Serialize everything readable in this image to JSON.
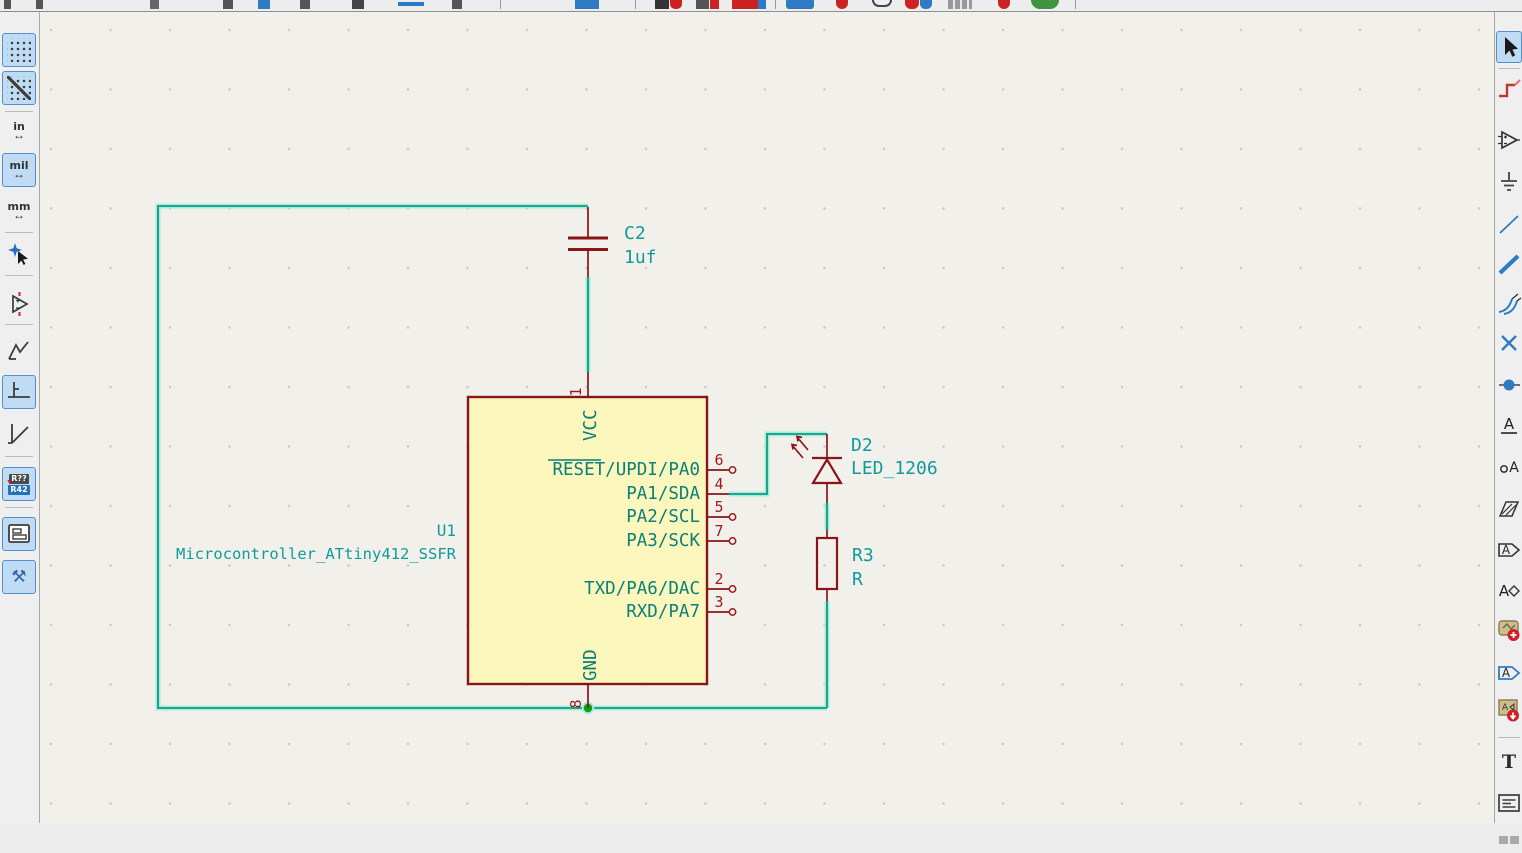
{
  "left_toolbar": {
    "buttons": [
      {
        "name": "grid-dots",
        "selected": true
      },
      {
        "name": "grid-overrides",
        "selected": true
      },
      {
        "name": "unit-inches",
        "label": "in",
        "selected": false
      },
      {
        "name": "unit-mils",
        "label": "mil",
        "selected": true
      },
      {
        "name": "unit-mm",
        "label": "mm",
        "selected": false
      },
      {
        "name": "crosshair-cursor",
        "selected": false
      },
      {
        "name": "show-hidden-pins",
        "selected": false
      },
      {
        "name": "free-angle-wires",
        "selected": false
      },
      {
        "name": "hv-wires",
        "selected": true
      },
      {
        "name": "45deg-wires",
        "selected": false
      },
      {
        "name": "annotate",
        "label_top": "R??",
        "label_bottom": "R42",
        "selected": true
      },
      {
        "name": "hierarchy-navigator",
        "selected": true
      },
      {
        "name": "schematic-setup",
        "selected": true
      }
    ]
  },
  "right_toolbar": {
    "buttons": [
      {
        "name": "select-tool",
        "selected": true
      },
      {
        "name": "highlight-net-tool",
        "selected": false
      },
      {
        "name": "place-symbol-tool",
        "selected": false
      },
      {
        "name": "place-power-port-tool",
        "selected": false
      },
      {
        "name": "draw-wire-tool",
        "selected": false
      },
      {
        "name": "draw-bus-tool",
        "selected": false
      },
      {
        "name": "wire-to-bus-entry-tool",
        "selected": false
      },
      {
        "name": "no-connect-tool",
        "selected": false
      },
      {
        "name": "junction-tool",
        "selected": false
      },
      {
        "name": "net-label-tool",
        "glyph": "A",
        "selected": false
      },
      {
        "name": "directive-label-tool",
        "glyph": "A",
        "selected": false
      },
      {
        "name": "rule-area-tool",
        "selected": false
      },
      {
        "name": "hierarchical-label-tool",
        "glyph": "A",
        "selected": false
      },
      {
        "name": "symbol-text-shape-tool",
        "glyph": "A",
        "selected": false
      },
      {
        "name": "place-sheet-tool",
        "selected": false
      },
      {
        "name": "global-label-tool",
        "glyph": "A",
        "selected": false
      },
      {
        "name": "import-sheet-pin-tool",
        "glyph": "A",
        "selected": false
      },
      {
        "name": "text-tool",
        "glyph": "T",
        "selected": false
      },
      {
        "name": "text-box-tool",
        "selected": false
      },
      {
        "name": "partially-visible-tool",
        "selected": false
      }
    ]
  },
  "schematic": {
    "components": {
      "C2": {
        "reference": "C2",
        "value": "1uf",
        "type": "capacitor"
      },
      "U1": {
        "reference": "U1",
        "value": "Microcontroller_ATtiny412_SSFR",
        "type": "microcontroller",
        "pins": [
          {
            "number": "1",
            "name": "VCC"
          },
          {
            "number": "6",
            "name": "RESET/UPDI/PA0"
          },
          {
            "number": "4",
            "name": "PA1/SDA"
          },
          {
            "number": "5",
            "name": "PA2/SCL"
          },
          {
            "number": "7",
            "name": "PA3/SCK"
          },
          {
            "number": "2",
            "name": "TXD/PA6/DAC"
          },
          {
            "number": "3",
            "name": "RXD/PA7"
          },
          {
            "number": "8",
            "name": "GND"
          }
        ]
      },
      "D2": {
        "reference": "D2",
        "value": "LED_1206",
        "type": "led"
      },
      "R3": {
        "reference": "R3",
        "value": "R",
        "type": "resistor"
      }
    },
    "colors": {
      "wire": "#0a9e7b",
      "wire_highlight_halo": "#a8ebe1",
      "symbol_outline": "#8a1518",
      "symbol_fill": "#fbf7bc",
      "field_text": "#119a9a",
      "pin_name_text": "#0b7f7a",
      "pin_number_text": "#9b1a1a",
      "junction_dot": "#12a012",
      "canvas_background": "#f1f0eb",
      "selected_button_background": "#bfdcf4"
    }
  }
}
